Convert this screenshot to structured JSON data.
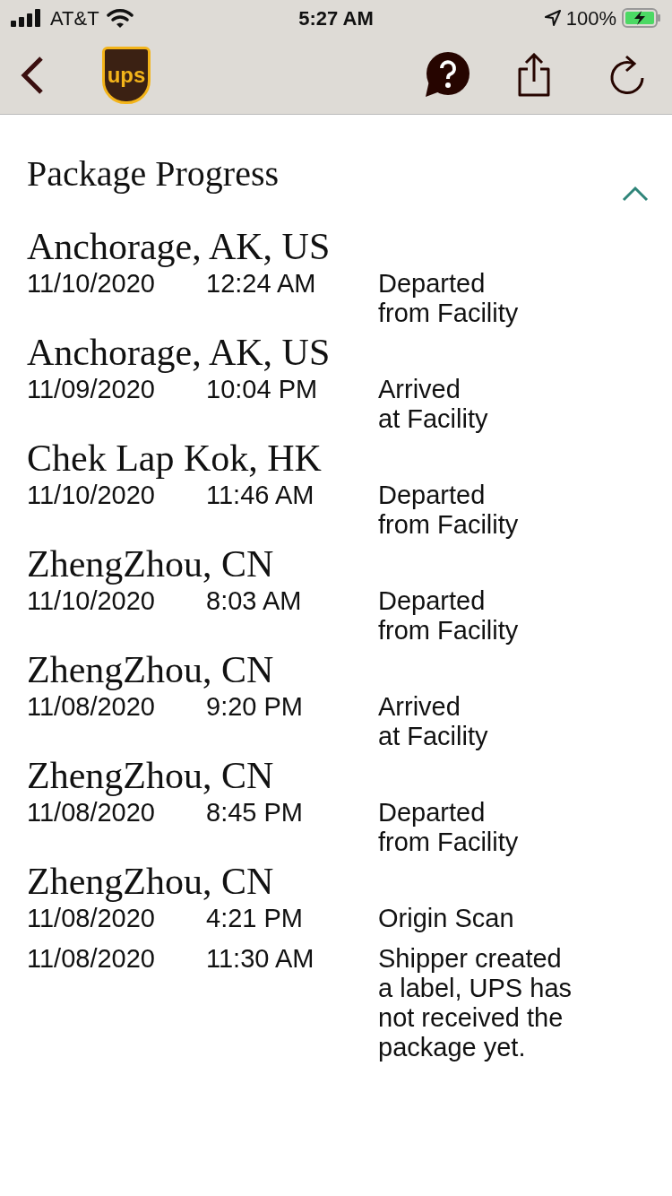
{
  "status_bar": {
    "carrier": "AT&T",
    "time": "5:27 AM",
    "battery": "100%"
  },
  "header": {
    "logo_text": "ups"
  },
  "section": {
    "title": "Package Progress",
    "expanded": true
  },
  "events": [
    {
      "location": "Anchorage, AK, US",
      "date": "11/10/2020",
      "time": "12:24 AM",
      "activity_lines": [
        "Departed",
        "from Facility"
      ]
    },
    {
      "location": "Anchorage, AK, US",
      "date": "11/09/2020",
      "time": "10:04 PM",
      "activity_lines": [
        "Arrived",
        "at Facility"
      ]
    },
    {
      "location": "Chek Lap Kok, HK",
      "date": "11/10/2020",
      "time": "11:46 AM",
      "activity_lines": [
        "Departed",
        "from Facility"
      ]
    },
    {
      "location": "ZhengZhou, CN",
      "date": "11/10/2020",
      "time": "8:03 AM",
      "activity_lines": [
        "Departed",
        "from Facility"
      ]
    },
    {
      "location": "ZhengZhou, CN",
      "date": "11/08/2020",
      "time": "9:20 PM",
      "activity_lines": [
        "Arrived",
        "at Facility"
      ]
    },
    {
      "location": "ZhengZhou, CN",
      "date": "11/08/2020",
      "time": "8:45 PM",
      "activity_lines": [
        "Departed",
        "from Facility"
      ]
    },
    {
      "location": "ZhengZhou, CN",
      "date": "11/08/2020",
      "time": "4:21 PM",
      "activity_lines": [
        "Origin Scan"
      ]
    },
    {
      "date": "11/08/2020",
      "time": "11:30 AM",
      "activity_lines": [
        "Shipper created",
        "a label, UPS has",
        "not received the",
        "package yet."
      ]
    }
  ]
}
